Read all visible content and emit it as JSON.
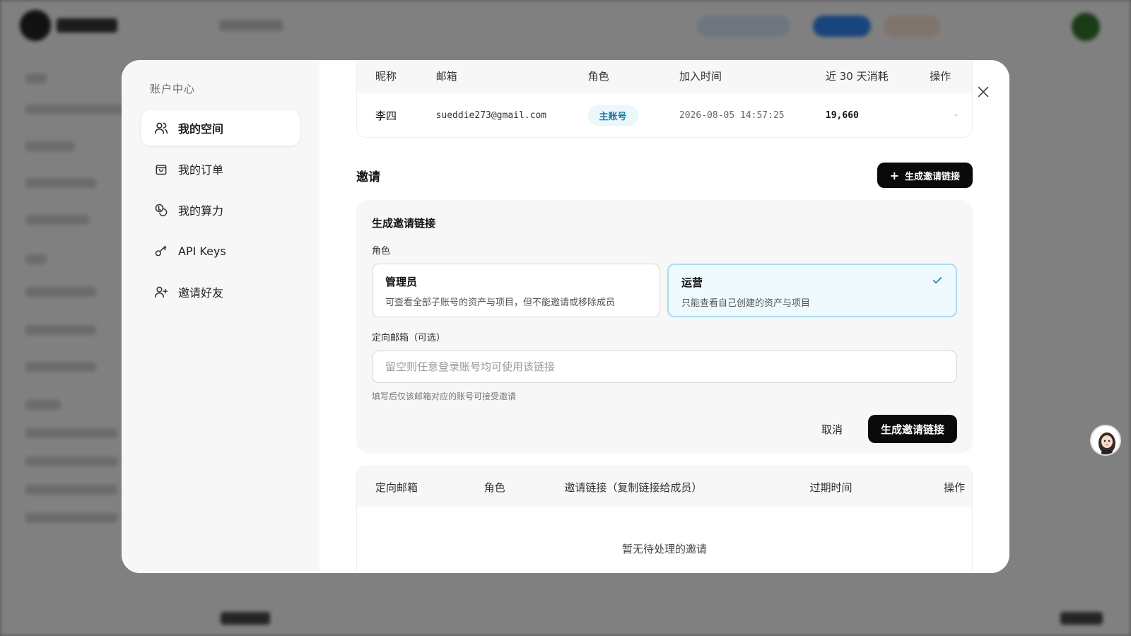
{
  "sidebar": {
    "title": "账户中心",
    "items": [
      {
        "label": "我的空间",
        "icon": "users-icon"
      },
      {
        "label": "我的订单",
        "icon": "shopping-bag-icon"
      },
      {
        "label": "我的算力",
        "icon": "coins-icon"
      },
      {
        "label": "API Keys",
        "icon": "key-icon"
      },
      {
        "label": "邀请好友",
        "icon": "user-plus-icon"
      }
    ]
  },
  "members": {
    "headers": {
      "nick": "昵称",
      "email": "邮箱",
      "role": "角色",
      "joined": "加入时间",
      "cost": "近 30 天消耗",
      "op": "操作"
    },
    "rows": [
      {
        "nick": "李四",
        "email": "sueddie273@gmail.com",
        "role": "主账号",
        "joined": "2026-08-05 14:57:25",
        "cost": "19,660",
        "op": "-"
      }
    ]
  },
  "invite": {
    "title": "邀请",
    "generate_button": "生成邀请链接"
  },
  "generate_form": {
    "title": "生成邀请链接",
    "role_label": "角色",
    "roles": [
      {
        "name": "管理员",
        "desc": "可查看全部子账号的资产与项目，但不能邀请或移除成员",
        "selected": false
      },
      {
        "name": "运营",
        "desc": "只能查看自己创建的资产与项目",
        "selected": true
      }
    ],
    "email_label": "定向邮箱（可选）",
    "email_placeholder": "留空则任意登录账号均可使用该链接",
    "email_value": "",
    "hint": "填写后仅该邮箱对应的账号可接受邀请",
    "cancel": "取消",
    "submit": "生成邀请链接"
  },
  "invites_table": {
    "headers": {
      "email": "定向邮箱",
      "role": "角色",
      "link": "邀请链接（复制链接给成员）",
      "expires": "过期时间",
      "op": "操作"
    },
    "empty": "暂无待处理的邀请"
  },
  "colors": {
    "accent": "#0a0a0a",
    "badge_bg": "#eaf7fb",
    "badge_text": "#1a7ca6",
    "selected_border": "#a9dcee"
  }
}
